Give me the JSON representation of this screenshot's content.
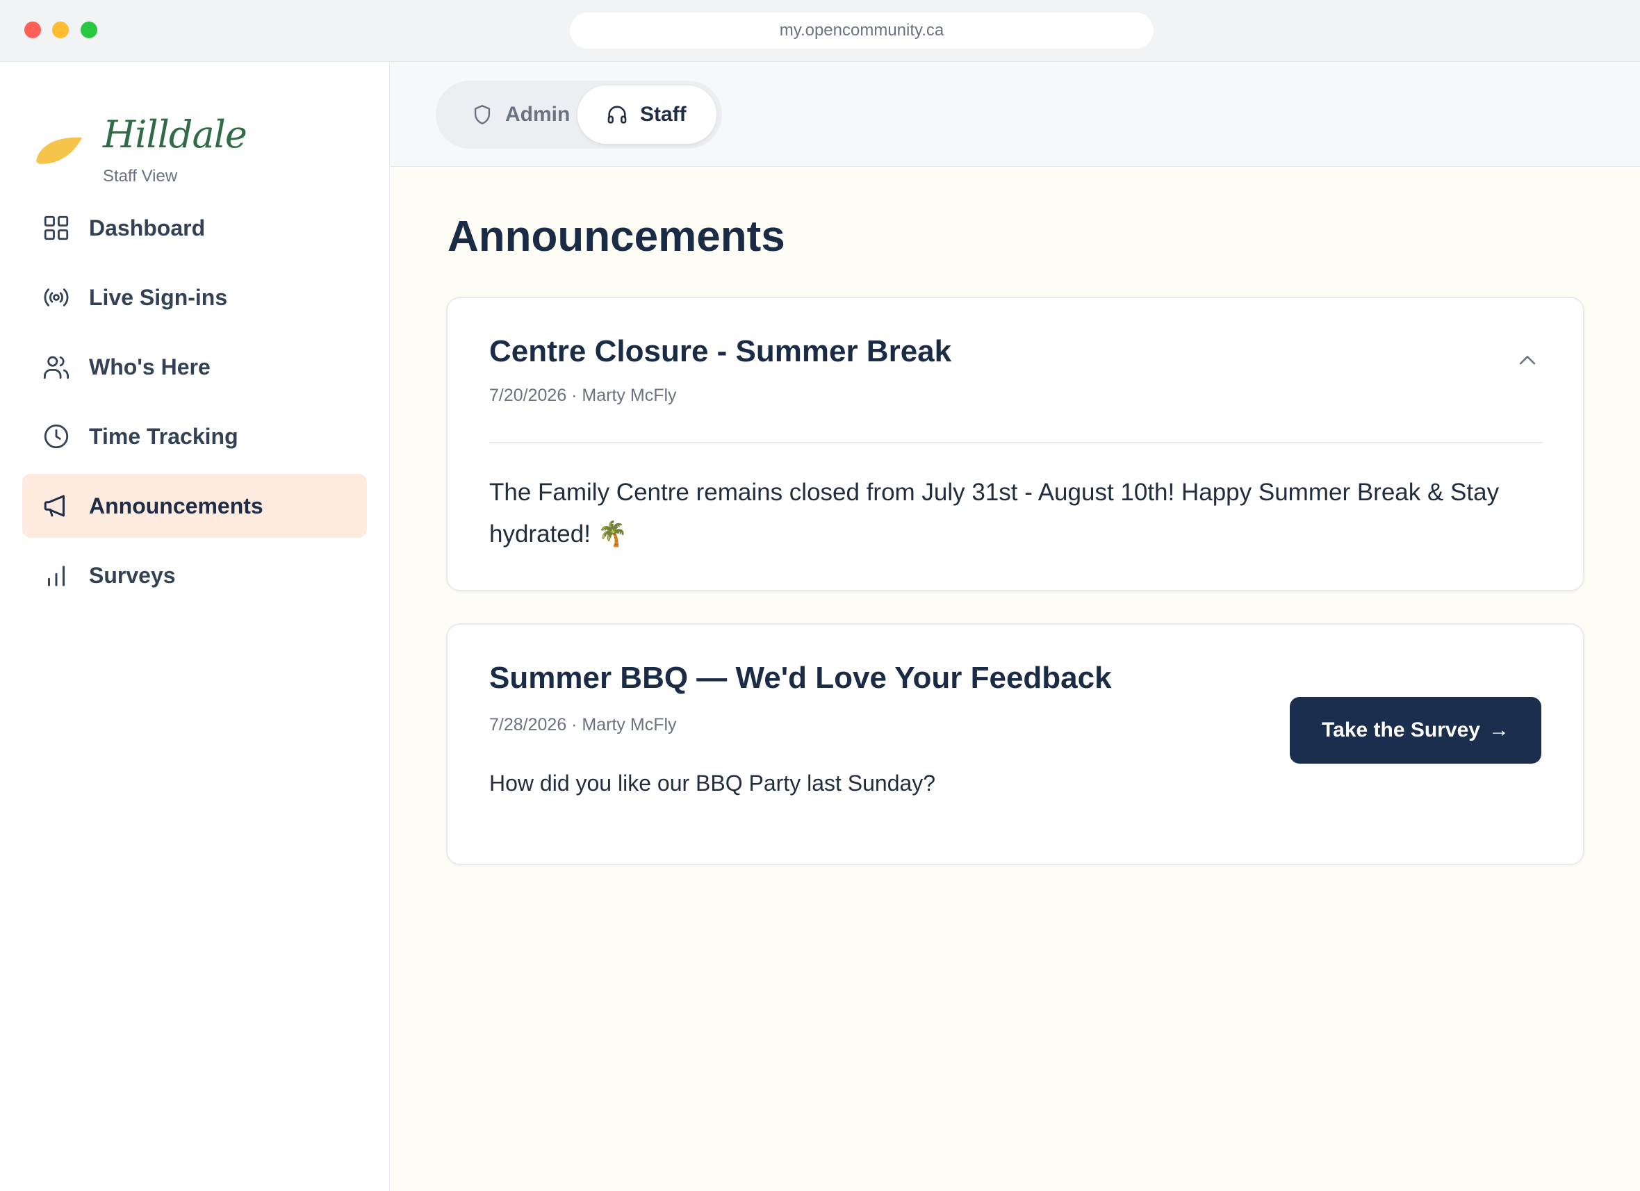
{
  "browser": {
    "url": "my.opencommunity.ca"
  },
  "brand": {
    "name": "Hilldale",
    "subtitle": "Staff View"
  },
  "sidebar": {
    "items": [
      {
        "label": "Dashboard",
        "icon": "grid-icon"
      },
      {
        "label": "Live Sign-ins",
        "icon": "broadcast-icon"
      },
      {
        "label": "Who's Here",
        "icon": "users-icon"
      },
      {
        "label": "Time Tracking",
        "icon": "clock-icon"
      },
      {
        "label": "Announcements",
        "icon": "megaphone-icon",
        "active": true
      },
      {
        "label": "Surveys",
        "icon": "bar-chart-icon"
      }
    ]
  },
  "role_toggle": {
    "admin_label": "Admin",
    "staff_label": "Staff",
    "selected": "Staff"
  },
  "main": {
    "title": "Announcements",
    "announcements": [
      {
        "title": "Centre Closure - Summer Break",
        "meta": "7/20/2026 · Marty McFly",
        "body": "The Family Centre remains closed from July 31st - August 10th! Happy Summer Break & Stay hydrated! 🌴",
        "expanded": true
      },
      {
        "title": "Summer BBQ — We'd Love Your Feedback",
        "meta": "7/28/2026 · Marty McFly",
        "body": "How did you like our BBQ Party last Sunday?",
        "action_label": "Take the Survey",
        "action_arrow": "→"
      }
    ]
  },
  "colors": {
    "accent_navy": "#1b2e4d",
    "active_nav_bg": "#fdebe0",
    "brand_green": "#2f6b45",
    "leaf_yellow": "#f6c44a",
    "main_bg": "#fdfcf5"
  }
}
